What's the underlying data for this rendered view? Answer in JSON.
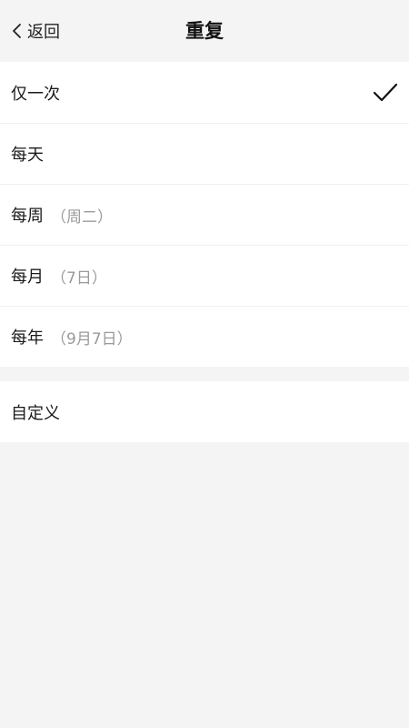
{
  "header": {
    "back_label": "返回",
    "title": "重复"
  },
  "options": [
    {
      "label": "仅一次",
      "hint": "",
      "selected": true
    },
    {
      "label": "每天",
      "hint": "",
      "selected": false
    },
    {
      "label": "每周",
      "hint": "（周二）",
      "selected": false
    },
    {
      "label": "每月",
      "hint": "（7日）",
      "selected": false
    },
    {
      "label": "每年",
      "hint": "（9月7日）",
      "selected": false
    }
  ],
  "custom": {
    "label": "自定义"
  },
  "icons": {
    "back": "chevron-left-icon",
    "check": "checkmark-icon"
  }
}
